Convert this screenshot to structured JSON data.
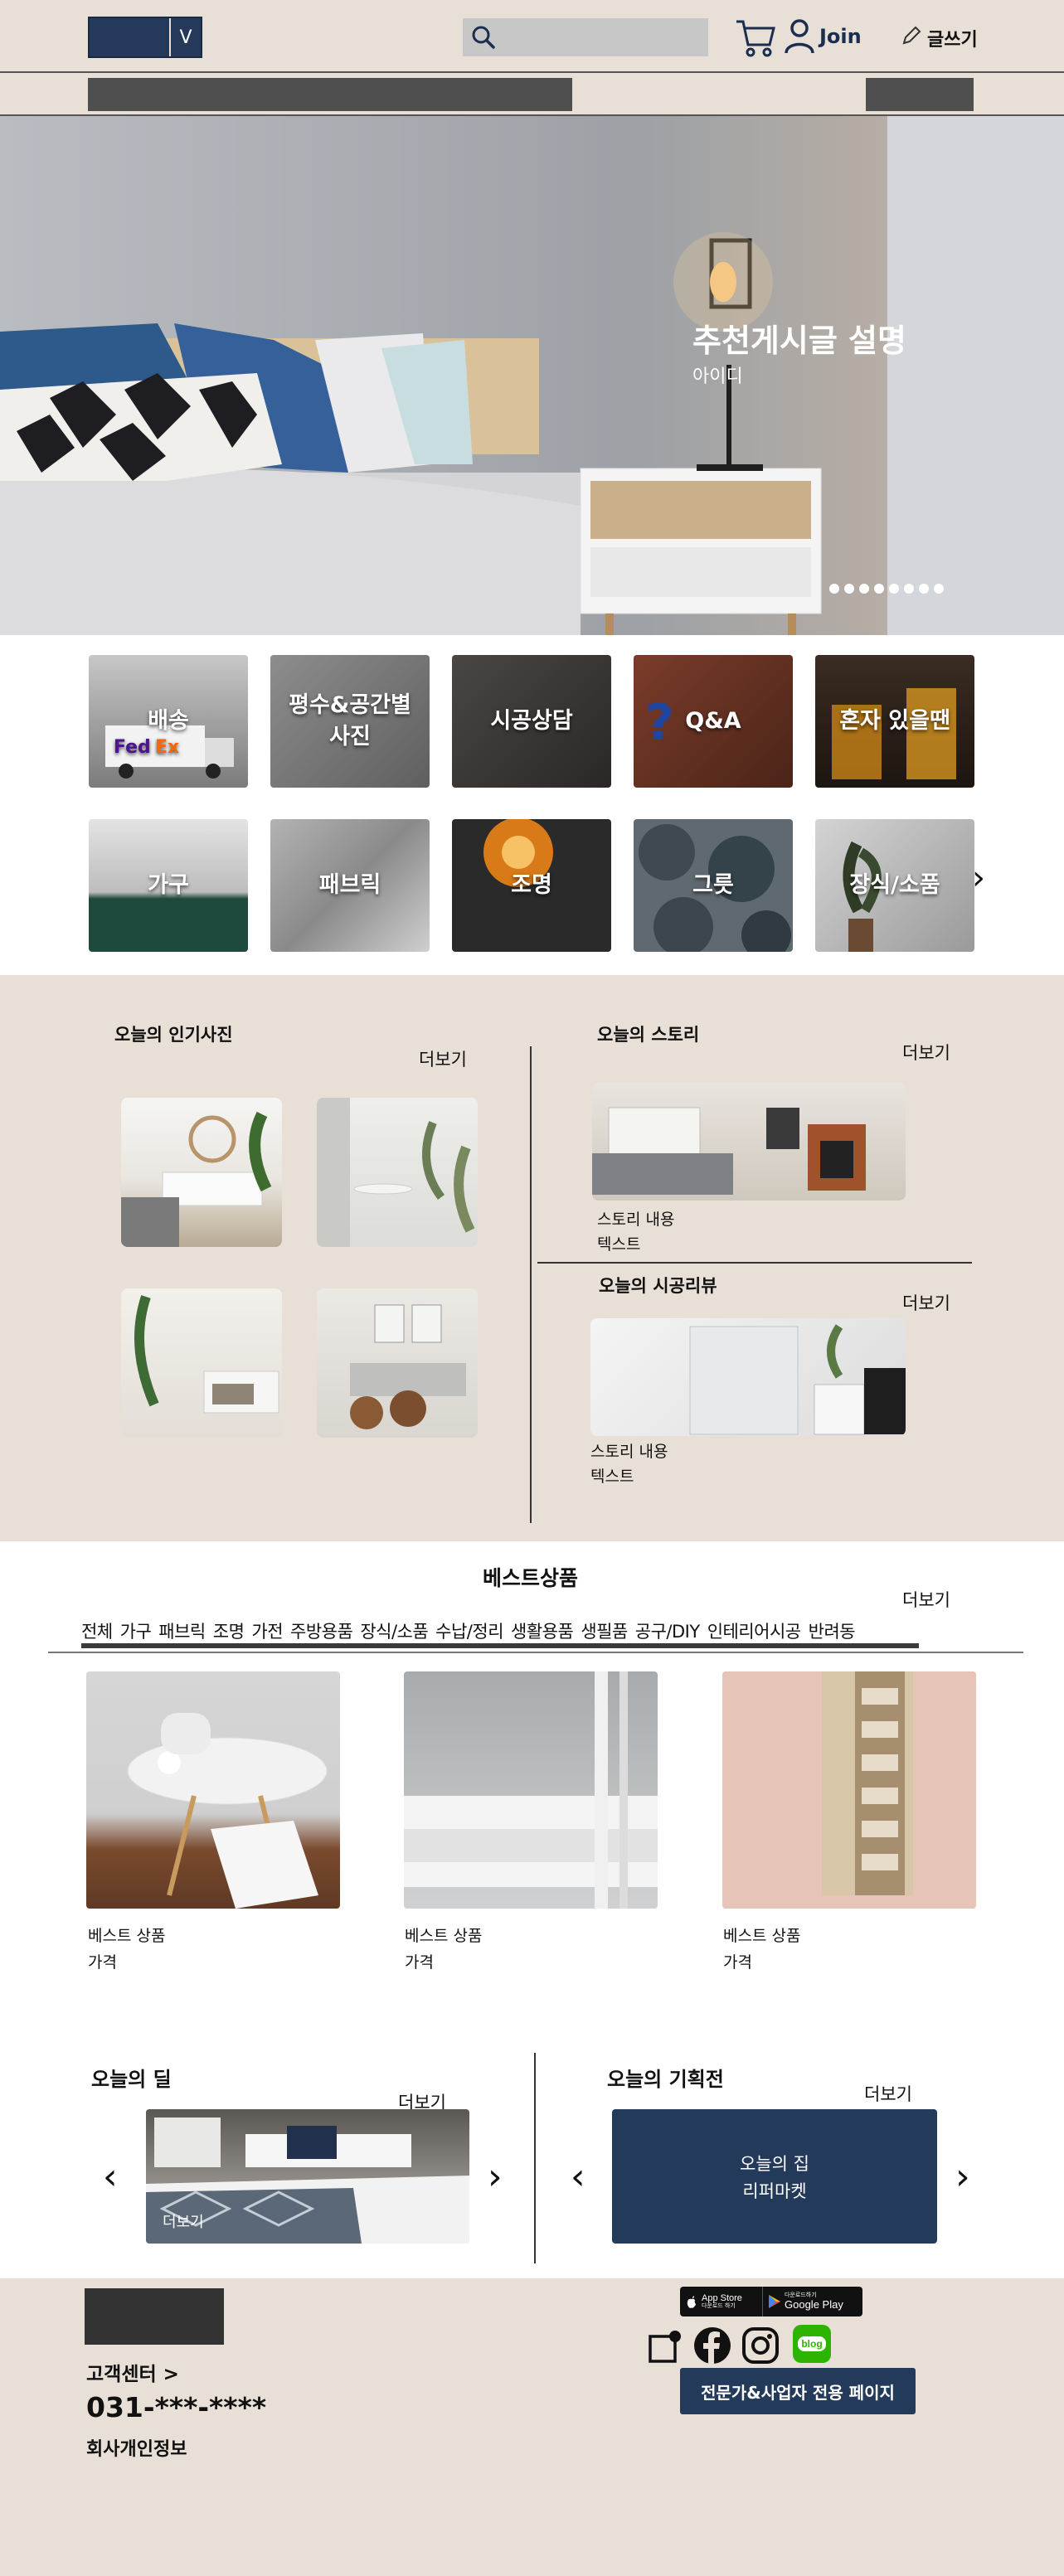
{
  "header": {
    "logo_letter": "V",
    "join_label": "Join",
    "write_label": "글쓰기"
  },
  "hero": {
    "title": "추천게시글 설명",
    "subtitle": "아이디",
    "slide_count": 8
  },
  "categories": [
    {
      "label": "배송"
    },
    {
      "label": "평수&공간별\n사진"
    },
    {
      "label": "시공상담"
    },
    {
      "label": "Q&A"
    },
    {
      "label": "혼자 있을땐"
    },
    {
      "label": "가구"
    },
    {
      "label": "패브릭"
    },
    {
      "label": "조명"
    },
    {
      "label": "그릇"
    },
    {
      "label": "장식/소품"
    }
  ],
  "popular": {
    "title": "오늘의 인기사진",
    "more": "더보기"
  },
  "story": {
    "title": "오늘의 스토리",
    "more": "더보기",
    "line1": "스토리 내용",
    "line2": "텍스트"
  },
  "review": {
    "title": "오늘의 시공리뷰",
    "more": "더보기",
    "line1": "스토리 내용",
    "line2": "텍스트"
  },
  "best": {
    "title": "베스트상품",
    "more": "더보기",
    "tabs": [
      "전체",
      "가구",
      "패브릭",
      "조명",
      "가전",
      "주방용품",
      "장식/소품",
      "수납/정리",
      "생활용품",
      "생필품",
      "공구/DIY",
      "인테리어시공",
      "반려동"
    ],
    "products": [
      {
        "name": "베스트 상품",
        "price": "가격"
      },
      {
        "name": "베스트 상품",
        "price": "가격"
      },
      {
        "name": "베스트 상품",
        "price": "가격"
      }
    ]
  },
  "deal": {
    "title": "오늘의 딜",
    "more": "더보기",
    "caption": "더보기"
  },
  "plan": {
    "title": "오늘의 기획전",
    "more": "더보기",
    "card_line1": "오늘의 집",
    "card_line2": "리퍼마켓"
  },
  "footer": {
    "cs": "고객센터 >",
    "phone": "031-***-****",
    "privacy": "회사개인정보",
    "app_store_small": "App Store",
    "app_store_tiny": "다운로드 하기",
    "google_small": "Google Play",
    "google_tiny": "다운로드하기",
    "blog": "blog",
    "pro_button": "전문가&사업자 전용 페이지"
  }
}
